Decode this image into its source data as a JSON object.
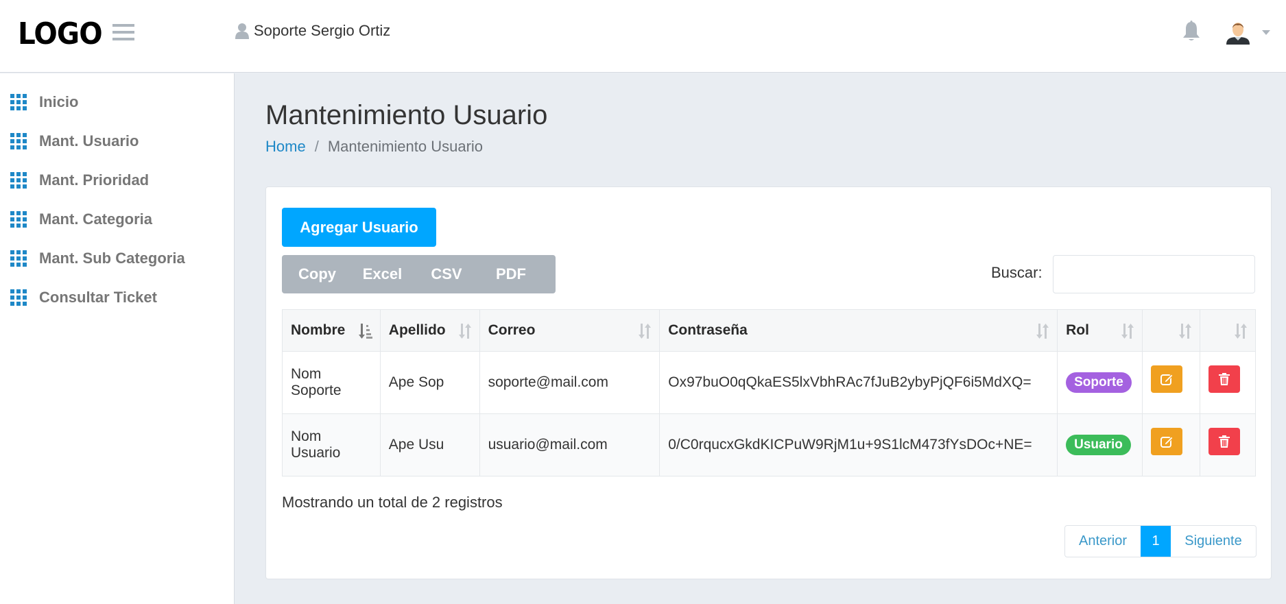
{
  "header": {
    "logo": "LOGO",
    "user_name": "Soporte Sergio Ortiz",
    "icons": {
      "menu": "hamburger-icon",
      "user": "user-silhouette-icon",
      "notifications": "bell-icon",
      "avatar": "avatar-icon",
      "dropdown": "caret-down-icon"
    }
  },
  "sidebar": {
    "items": [
      {
        "label": "Inicio",
        "icon": "grid-icon"
      },
      {
        "label": "Mant. Usuario",
        "icon": "grid-icon"
      },
      {
        "label": "Mant. Prioridad",
        "icon": "grid-icon"
      },
      {
        "label": "Mant. Categoria",
        "icon": "grid-icon"
      },
      {
        "label": "Mant. Sub Categoria",
        "icon": "grid-icon"
      },
      {
        "label": "Consultar Ticket",
        "icon": "grid-icon"
      }
    ]
  },
  "page": {
    "title": "Mantenimiento Usuario",
    "breadcrumb": {
      "home": "Home",
      "separator": "/",
      "current": "Mantenimiento Usuario"
    }
  },
  "toolbar": {
    "add_label": "Agregar Usuario",
    "export": [
      "Copy",
      "Excel",
      "CSV",
      "PDF"
    ],
    "search_label": "Buscar:",
    "search_value": ""
  },
  "table": {
    "columns": [
      "Nombre",
      "Apellido",
      "Correo",
      "Contraseña",
      "Rol",
      "",
      ""
    ],
    "sorted_column": "Nombre",
    "rows": [
      {
        "nombre": "Nom Soporte",
        "apellido": "Ape Sop",
        "correo": "soporte@mail.com",
        "contrasena": "Ox97buO0qQkaES5lxVbhRAc7fJuB2ybyPjQF6i5MdXQ=",
        "rol": "Soporte",
        "rol_color": "#a461e0"
      },
      {
        "nombre": "Nom Usuario",
        "apellido": "Ape Usu",
        "correo": "usuario@mail.com",
        "contrasena": "0/C0rqucxGkdKICPuW9RjM1u+9S1lcM473fYsDOc+NE=",
        "rol": "Usuario",
        "rol_color": "#3cbc5a"
      }
    ]
  },
  "footer": {
    "info": "Mostrando un total de 2 registros",
    "pagination": {
      "prev": "Anterior",
      "current": "1",
      "next": "Siguiente"
    }
  },
  "colors": {
    "primary": "#00a6ff",
    "edit": "#f0a020",
    "delete": "#f2404b",
    "nav_icon": "#1e88c7"
  }
}
